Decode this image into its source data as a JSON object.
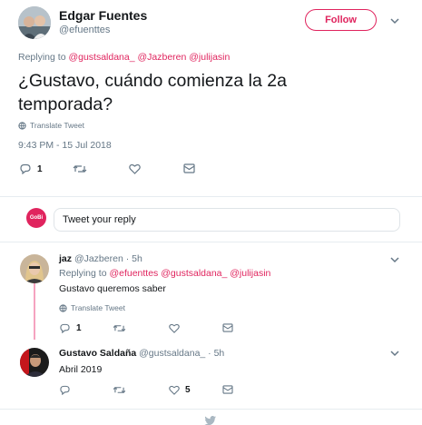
{
  "main_tweet": {
    "author_name": "Edgar Fuentes",
    "author_handle": "@efuenttes",
    "follow_label": "Follow",
    "replying_prefix": "Replying to",
    "replying_handles": "@gustsaldana_ @Jazberen @julijasin",
    "text": "¿Gustavo, cuándo comienza la 2a temporada?",
    "translate_label": "Translate Tweet",
    "timestamp": "9:43 PM - 15 Jul 2018",
    "reply_count": "1"
  },
  "compose": {
    "placeholder": "Tweet your reply",
    "avatar_text": "GoBi"
  },
  "replies": [
    {
      "author_name": "jaz",
      "author_handle": "@Jazberen · 5h",
      "replying_prefix": "Replying to",
      "replying_handles": "@efuenttes @gustsaldana_ @julijasin",
      "text": "Gustavo queremos saber",
      "translate_label": "Translate Tweet",
      "reply_count": "1"
    },
    {
      "author_name": "Gustavo Saldaña",
      "author_handle": "@gustsaldana_ · 5h",
      "text": "Abril 2019",
      "like_count": "5"
    }
  ],
  "colors": {
    "accent": "#e0245e",
    "muted": "#657786",
    "thread_line": "#f5a3c0"
  },
  "icons": [
    "chevron-down-icon",
    "globe-icon",
    "reply-icon",
    "retweet-icon",
    "heart-icon",
    "dm-icon",
    "twitter-bird-icon"
  ]
}
